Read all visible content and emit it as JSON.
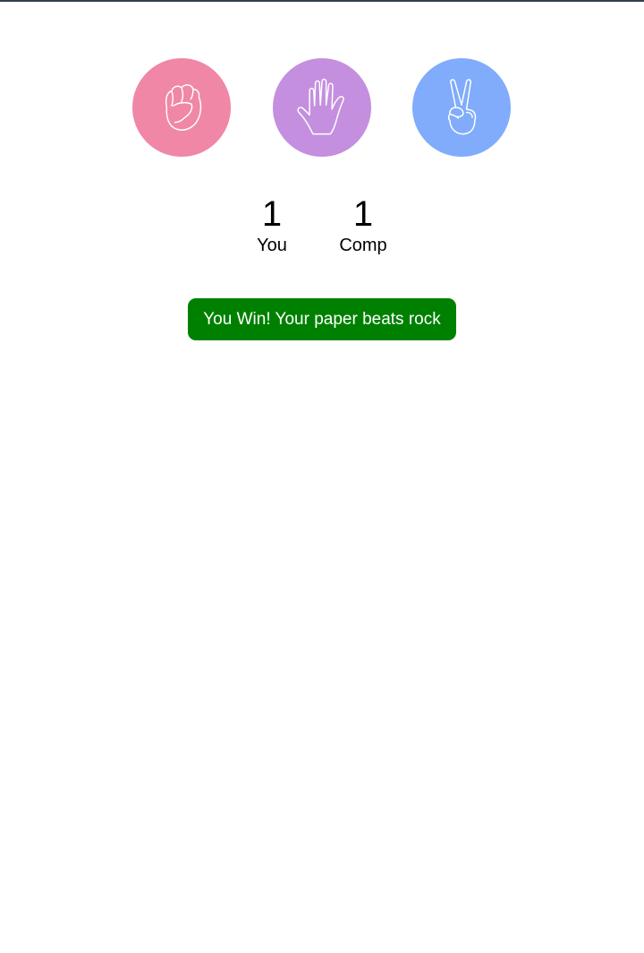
{
  "choices": [
    {
      "name": "rock",
      "icon": "fist-icon",
      "color": "#f087a6"
    },
    {
      "name": "paper",
      "icon": "open-hand-icon",
      "color": "#c48fdf"
    },
    {
      "name": "scissors",
      "icon": "victory-hand-icon",
      "color": "#80acfb"
    }
  ],
  "scoreboard": {
    "you": {
      "score": "1",
      "label": "You"
    },
    "comp": {
      "score": "1",
      "label": "Comp"
    }
  },
  "result": {
    "message": "You Win! Your paper beats rock",
    "status_color": "#008000"
  },
  "colors": {
    "background": "#ffffff",
    "top_bar": "#2f3f4f"
  }
}
